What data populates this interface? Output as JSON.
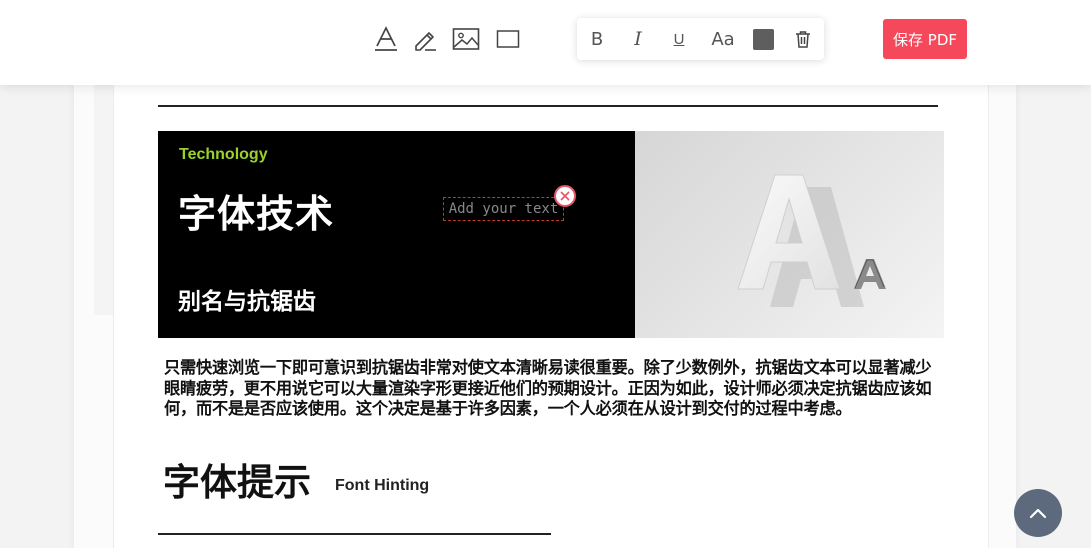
{
  "toolbar": {
    "tools": [
      {
        "name": "text-tool",
        "icon": "text-a-icon"
      },
      {
        "name": "pen-tool",
        "icon": "pencil-icon"
      },
      {
        "name": "image-tool",
        "icon": "image-icon"
      },
      {
        "name": "shape-tool",
        "icon": "rectangle-icon"
      }
    ],
    "format": {
      "bold_label": "B",
      "italic_label": "I",
      "underline_label": "U",
      "font_size_label": "Aa",
      "color_swatch": "#5e5e5e",
      "delete_icon": "trash-icon"
    },
    "save_label": "保存 PDF",
    "save_color": "#f5495b"
  },
  "document": {
    "hero": {
      "tag": "Technology",
      "tag_color": "#9bd12b",
      "title": "字体技术",
      "subtitle": "别名与抗锯齿",
      "image_letters": {
        "big": "A",
        "small": "A"
      }
    },
    "text_box": {
      "placeholder": "Add your text"
    },
    "body": "只需快速浏览一下即可意识到抗锯齿非常对使文本清晰易读很重要。除了少数例外，抗锯齿文本可以显著减少眼睛疲劳，更不用说它可以大量渲染字形更接近他们的预期设计。正因为如此，设计师必须决定抗锯齿应该如何，而不是是否应该使用。这个决定是基于许多因素，一个人必须在从设计到交付的过程中考虑。",
    "section_heading": "字体提示",
    "section_subheading": "Font Hinting"
  },
  "scroll_top_icon": "chevron-up-icon"
}
